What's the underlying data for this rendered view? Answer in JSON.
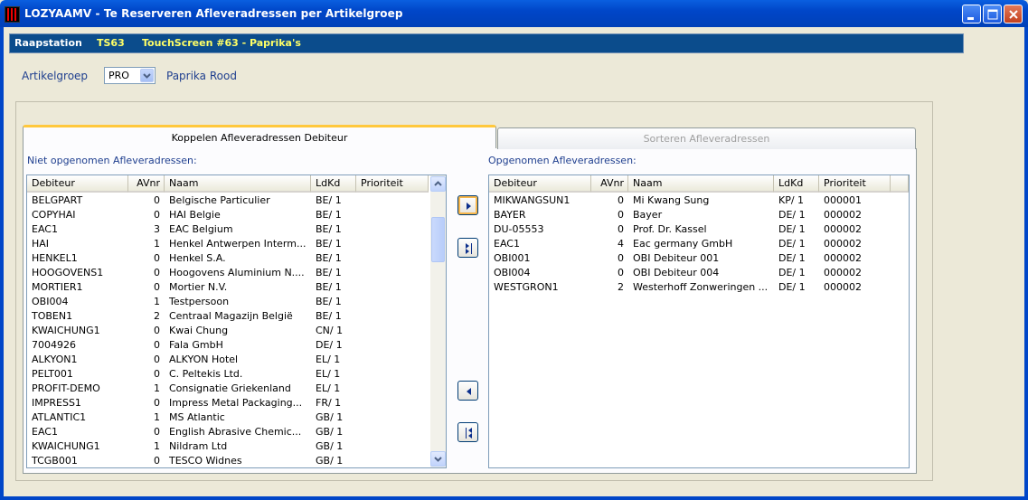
{
  "window": {
    "title": "LOZYAAMV - Te Reserveren Afleveradressen per Artikelgroep"
  },
  "infobar": {
    "label": "Raapstation",
    "code": "TS63",
    "name": "TouchScreen #63 - Paprika's",
    "colors": {
      "label": "#ffffff",
      "code": "#ffff66",
      "name": "#ffff66"
    }
  },
  "artikelgroep": {
    "label": "Artikelgroep",
    "value": "PRO",
    "description": "Paprika Rood"
  },
  "tabs": [
    {
      "label": "Koppelen Afleveradressen Debiteur",
      "active": true
    },
    {
      "label": "Sorteren Afleveradressen",
      "active": false
    }
  ],
  "left_list": {
    "title": "Niet opgenomen Afleveradressen:",
    "columns": [
      "Debiteur",
      "AVnr",
      "Naam",
      "LdKd",
      "Prioriteit"
    ],
    "rows": [
      [
        "BELGPART",
        "0",
        "Belgische Particulier",
        "BE/ 1",
        ""
      ],
      [
        "COPYHAI",
        "0",
        "HAI Belgie",
        "BE/ 1",
        ""
      ],
      [
        "EAC1",
        "3",
        "EAC Belgium",
        "BE/ 1",
        ""
      ],
      [
        "HAI",
        "1",
        "Henkel Antwerpen Interm...",
        "BE/ 1",
        ""
      ],
      [
        "HENKEL1",
        "0",
        "Henkel S.A.",
        "BE/ 1",
        ""
      ],
      [
        "HOOGOVENS1",
        "0",
        "Hoogovens Aluminium N....",
        "BE/ 1",
        ""
      ],
      [
        "MORTIER1",
        "0",
        "Mortier N.V.",
        "BE/ 1",
        ""
      ],
      [
        "OBI004",
        "1",
        "Testpersoon",
        "BE/ 1",
        ""
      ],
      [
        "TOBEN1",
        "2",
        "Centraal Magazijn België",
        "BE/ 1",
        ""
      ],
      [
        "KWAICHUNG1",
        "0",
        "Kwai Chung",
        "CN/ 1",
        ""
      ],
      [
        "7004926",
        "0",
        "Fala GmbH",
        "DE/ 1",
        ""
      ],
      [
        "ALKYON1",
        "0",
        "ALKYON Hotel",
        "EL/ 1",
        ""
      ],
      [
        "PELT001",
        "0",
        "C. Peltekis Ltd.",
        "EL/ 1",
        ""
      ],
      [
        "PROFIT-DEMO",
        "1",
        "Consignatie Griekenland",
        "EL/ 1",
        ""
      ],
      [
        "IMPRESS1",
        "0",
        "Impress Metal Packaging...",
        "FR/ 1",
        ""
      ],
      [
        "ATLANTIC1",
        "1",
        "MS Atlantic",
        "GB/ 1",
        ""
      ],
      [
        "EAC1",
        "0",
        "English Abrasive Chemic...",
        "GB/ 1",
        ""
      ],
      [
        "KWAICHUNG1",
        "1",
        "Nildram Ltd",
        "GB/ 1",
        ""
      ],
      [
        "TCGB001",
        "0",
        "TESCO Widnes",
        "GB/ 1",
        ""
      ]
    ]
  },
  "right_list": {
    "title": "Opgenomen Afleveradressen:",
    "columns": [
      "Debiteur",
      "AVnr",
      "Naam",
      "LdKd",
      "Prioriteit"
    ],
    "rows": [
      [
        "MIKWANGSUN1",
        "0",
        "Mi Kwang Sung",
        "KP/ 1",
        "000001"
      ],
      [
        "BAYER",
        "0",
        "Bayer",
        "DE/ 1",
        "000002"
      ],
      [
        "DU-05553",
        "0",
        "Prof. Dr. Kassel",
        "DE/ 1",
        "000002"
      ],
      [
        "EAC1",
        "4",
        "Eac germany GmbH",
        "DE/ 1",
        "000002"
      ],
      [
        "OBI001",
        "0",
        "OBI Debiteur 001",
        "DE/ 1",
        "000002"
      ],
      [
        "OBI004",
        "0",
        "OBI Debiteur 004",
        "DE/ 1",
        "000002"
      ],
      [
        "WESTGRON1",
        "2",
        "Westerhoff Zonweringen ...",
        "DE/ 1",
        "000002"
      ]
    ]
  },
  "icons": {
    "move_right": "move-right-icon",
    "move_all_right": "move-all-right-icon",
    "move_left": "move-left-icon",
    "move_all_left": "move-all-left-icon"
  }
}
